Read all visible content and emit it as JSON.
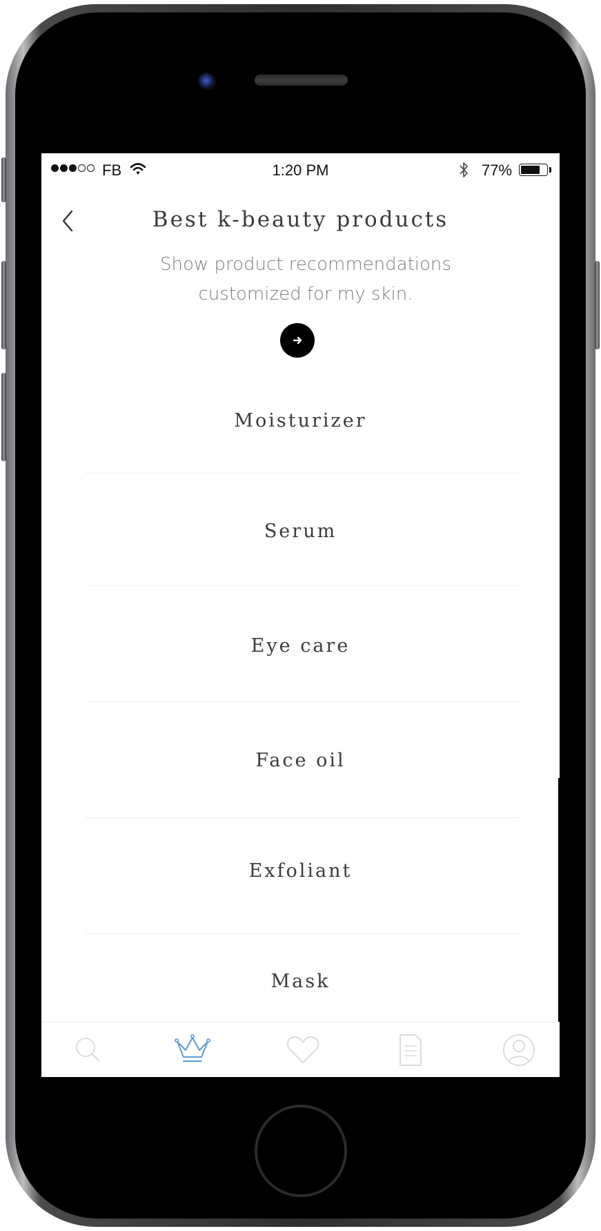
{
  "status_bar": {
    "carrier": "FB",
    "time": "1:20 PM",
    "battery_percent": "77%",
    "battery_level": 0.77,
    "signal_bars_filled": 3,
    "signal_bars_total": 5
  },
  "header": {
    "title": "Best k-beauty products",
    "subtitle": "Show product recommendations customized for my skin."
  },
  "categories": [
    {
      "label": "Moisturizer"
    },
    {
      "label": "Serum"
    },
    {
      "label": "Eye care"
    },
    {
      "label": "Face oil"
    },
    {
      "label": "Exfoliant"
    },
    {
      "label": "Mask"
    }
  ],
  "tab_bar": {
    "active_tab": "rankings",
    "active_color": "#5b9bd5",
    "inactive_color": "#dcdcdc",
    "icons": [
      "search-icon",
      "crown-icon",
      "heart-icon",
      "document-icon",
      "profile-icon"
    ]
  }
}
